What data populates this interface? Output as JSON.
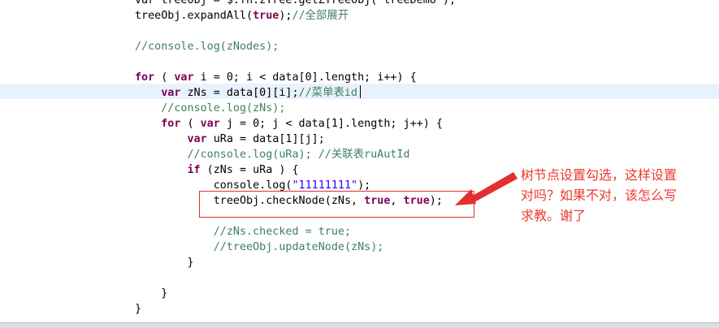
{
  "editor": {
    "lines": [
      [
        {
          "t": "p",
          "v": "var treeObj = $.fn.zTree.getZTreeObj(\"treeDemo\");"
        }
      ],
      [
        {
          "t": "p",
          "v": "treeObj.expandAll("
        },
        {
          "t": "k",
          "v": "true"
        },
        {
          "t": "p",
          "v": ");"
        },
        {
          "t": "c",
          "v": "//全部展开"
        }
      ],
      [],
      [
        {
          "t": "c",
          "v": "//console.log(zNodes);"
        }
      ],
      [],
      [
        {
          "t": "k",
          "v": "for"
        },
        {
          "t": "p",
          "v": " ( "
        },
        {
          "t": "k",
          "v": "var"
        },
        {
          "t": "p",
          "v": " i = 0; i < data[0].length; i++) {"
        }
      ],
      [
        {
          "t": "p",
          "v": "    "
        },
        {
          "t": "k",
          "v": "var"
        },
        {
          "t": "p",
          "v": " zNs = data[0][i];"
        },
        {
          "t": "c",
          "v": "//菜单表id"
        }
      ],
      [
        {
          "t": "p",
          "v": "    "
        },
        {
          "t": "c",
          "v": "//console.log(zNs);"
        }
      ],
      [
        {
          "t": "p",
          "v": "    "
        },
        {
          "t": "k",
          "v": "for"
        },
        {
          "t": "p",
          "v": " ( "
        },
        {
          "t": "k",
          "v": "var"
        },
        {
          "t": "p",
          "v": " j = 0; j < data[1].length; j++) {"
        }
      ],
      [
        {
          "t": "p",
          "v": "        "
        },
        {
          "t": "k",
          "v": "var"
        },
        {
          "t": "p",
          "v": " uRa = data[1][j];"
        }
      ],
      [
        {
          "t": "p",
          "v": "        "
        },
        {
          "t": "c",
          "v": "//console.log(uRa); //关联表ruAutId"
        }
      ],
      [
        {
          "t": "p",
          "v": "        "
        },
        {
          "t": "k",
          "v": "if"
        },
        {
          "t": "p",
          "v": " (zNs = uRa ) {"
        }
      ],
      [
        {
          "t": "p",
          "v": "            console.log("
        },
        {
          "t": "s",
          "v": "\"11111111\""
        },
        {
          "t": "p",
          "v": ");"
        }
      ],
      [
        {
          "t": "p",
          "v": "            treeObj.checkNode(zNs, "
        },
        {
          "t": "k",
          "v": "true"
        },
        {
          "t": "p",
          "v": ", "
        },
        {
          "t": "k",
          "v": "true"
        },
        {
          "t": "p",
          "v": ");"
        }
      ],
      [],
      [
        {
          "t": "p",
          "v": "            "
        },
        {
          "t": "c",
          "v": "//zNs.checked = true;"
        }
      ],
      [
        {
          "t": "p",
          "v": "            "
        },
        {
          "t": "c",
          "v": "//treeObj.updateNode(zNs);"
        }
      ],
      [
        {
          "t": "p",
          "v": "        }"
        }
      ],
      [],
      [
        {
          "t": "p",
          "v": "    }"
        }
      ],
      [
        {
          "t": "p",
          "v": "}"
        }
      ]
    ]
  },
  "annotation": {
    "text": "树节点设置勾选，这样设置\n对吗？如果不对，该怎么写\n求教。谢了",
    "color": "#ec3a2e"
  },
  "colors": {
    "keyword": "#7f0055",
    "comment": "#3f7f5f",
    "string": "#2a00ff",
    "current_line": "#e8f2fe"
  }
}
